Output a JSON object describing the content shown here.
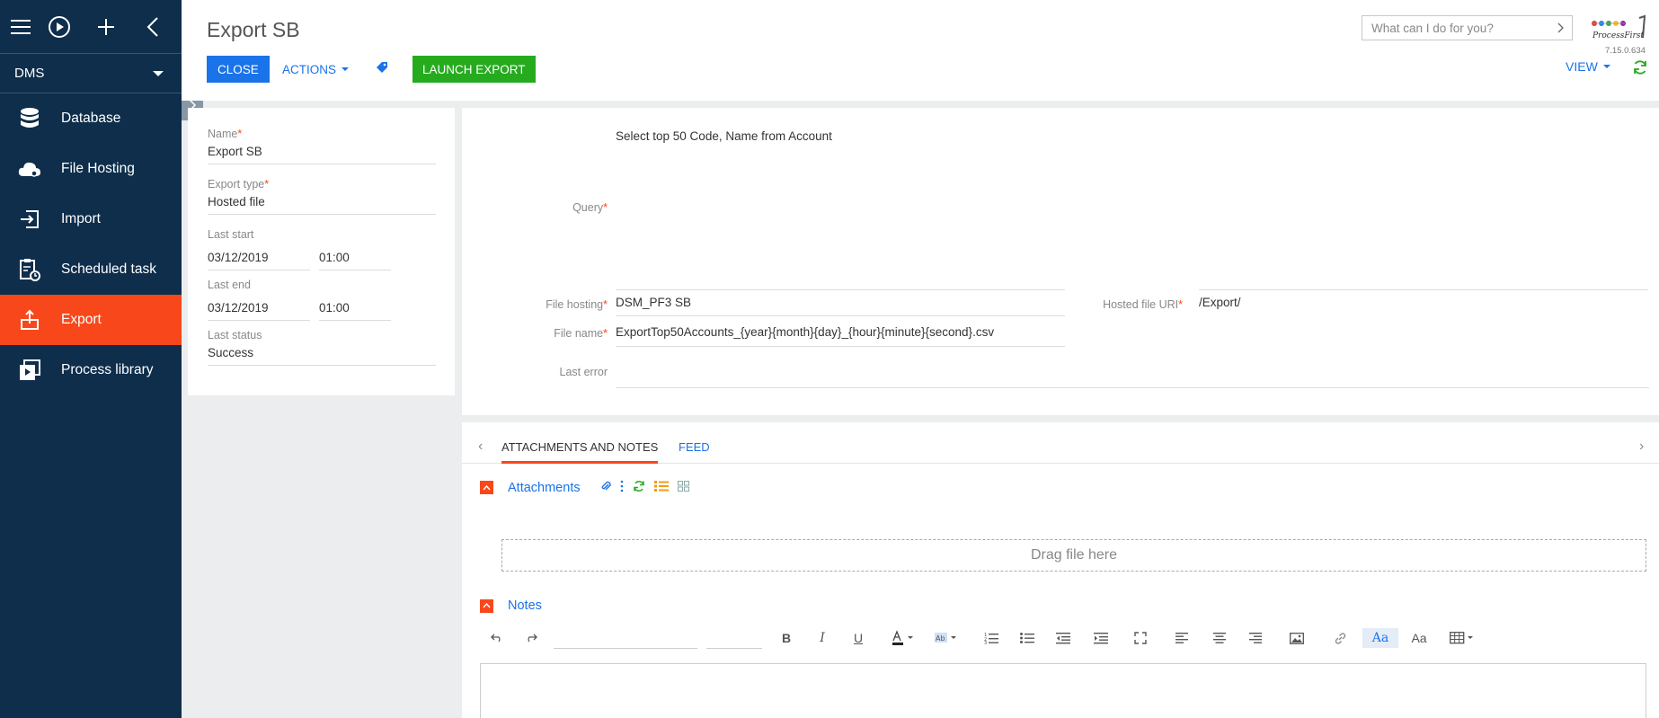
{
  "sidebar": {
    "selector": "DMS",
    "items": [
      {
        "label": "Database",
        "icon": "database-icon"
      },
      {
        "label": "File Hosting",
        "icon": "cloud-icon"
      },
      {
        "label": "Import",
        "icon": "import-icon"
      },
      {
        "label": "Scheduled task",
        "icon": "clipboard-clock-icon"
      },
      {
        "label": "Export",
        "icon": "export-icon",
        "active": true
      },
      {
        "label": "Process library",
        "icon": "process-library-icon"
      }
    ]
  },
  "header": {
    "title": "Export SB",
    "close_label": "CLOSE",
    "actions_label": "ACTIONS",
    "launch_label": "LAUNCH EXPORT",
    "search_placeholder": "What can I do for you?",
    "version": "7.15.0.634",
    "view_label": "VIEW",
    "logo_text": "ProcessFirst"
  },
  "left_form": {
    "name_label": "Name",
    "name_value": "Export SB",
    "type_label": "Export type",
    "type_value": "Hosted file",
    "last_start_label": "Last start",
    "last_start_date": "03/12/2019",
    "last_start_time": "01:00",
    "last_end_label": "Last end",
    "last_end_date": "03/12/2019",
    "last_end_time": "01:00",
    "last_status_label": "Last status",
    "last_status_value": "Success"
  },
  "right_form": {
    "query_label": "Query",
    "query_value": "Select top 50 Code, Name from Account",
    "file_hosting_label": "File hosting",
    "file_hosting_value": "DSM_PF3 SB",
    "hosted_uri_label": "Hosted file URI",
    "hosted_uri_value": "/Export/",
    "file_name_label": "File name",
    "file_name_value": "ExportTop50Accounts_{year}{month}{day}_{hour}{minute}{second}.csv",
    "last_error_label": "Last error",
    "last_error_value": ""
  },
  "tabs": [
    {
      "label": "ATTACHMENTS AND NOTES",
      "active": true
    },
    {
      "label": "FEED",
      "active": false
    }
  ],
  "attachments": {
    "title": "Attachments",
    "drop_text": "Drag file here"
  },
  "notes": {
    "title": "Notes"
  },
  "colors": {
    "sidebar": "#0e2e4b",
    "accent": "#f8481b",
    "primary": "#1a73e8",
    "launch": "#25ab1d"
  }
}
